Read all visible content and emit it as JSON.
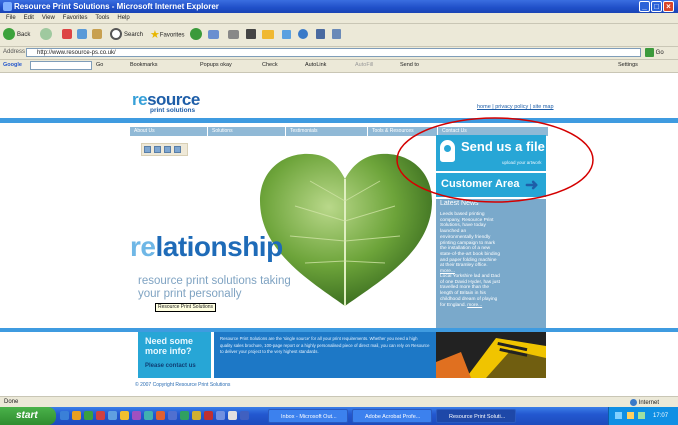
{
  "window": {
    "title": "Resource Print Solutions - Microsoft Internet Explorer"
  },
  "menu": [
    "File",
    "Edit",
    "View",
    "Favorites",
    "Tools",
    "Help"
  ],
  "toolbar": {
    "back": "Back",
    "search": "Search",
    "favorites": "Favorites"
  },
  "address": {
    "label": "Address",
    "url": "http://www.resource-ps.co.uk/",
    "go": "Go"
  },
  "googlebar": {
    "label": "Google",
    "go": "Go",
    "bookmarks": "Bookmarks",
    "popups": "Popups okay",
    "check": "Check",
    "autolink": "AutoLink",
    "autofill": "AutoFill",
    "sendto": "Send to",
    "settings": "Settings"
  },
  "site": {
    "logo_re": "re",
    "logo_rest": "source",
    "logo_sub": "print solutions",
    "top_links": "home | privacy policy | site map",
    "nav": [
      "About Us",
      "Solutions",
      "Testimonials",
      "Tools & Resources",
      "Contact Us"
    ],
    "send_title": "Send us a file",
    "send_sub": "upload your artwork",
    "customer_area": "Customer Area",
    "latest_heading": "Latest News",
    "news1": "Leeds based printing company, Resource Print Solutions, have today launched an environmentally friendly printing campaign to mark the installation of a new state-of-the-art book binding and paper folding machine at their Bramley office.",
    "news1_more": "more...",
    "news2": "Local Yorkshire lad and Dad of one David Hyder, has just travelled more than the length of Britain in his childhood dream of playing for England.",
    "news2_more": "more...",
    "headline_re": "re",
    "headline_rest": "lationship",
    "tagline1": "resource print solutions taking",
    "tagline2": "your print personally",
    "tooltip": "Resource Print Solutions",
    "need_info": "Need some more info?",
    "contact": "Please contact us",
    "about_text": "Resource Print Solutions are the 'single source' for all your print requirements. Whether you need a high quality sales brochure, 100-page report or a highly personalised piece of direct mail, you can rely on Resource to deliver your project to the very highest standards.",
    "copyright": "© 2007 Copyright Resource Print Solutions"
  },
  "status": {
    "left": "Done",
    "right": "Internet"
  },
  "taskbar": {
    "start": "start",
    "tasks": [
      "Inbox - Microsoft Out...",
      "Adobe Acrobat Profe...",
      "Resource Print Soluti..."
    ],
    "time": "17:07"
  },
  "colors": {
    "accent": "#27a6d6",
    "brand": "#1e5ea8",
    "annotation": "#d40000"
  }
}
